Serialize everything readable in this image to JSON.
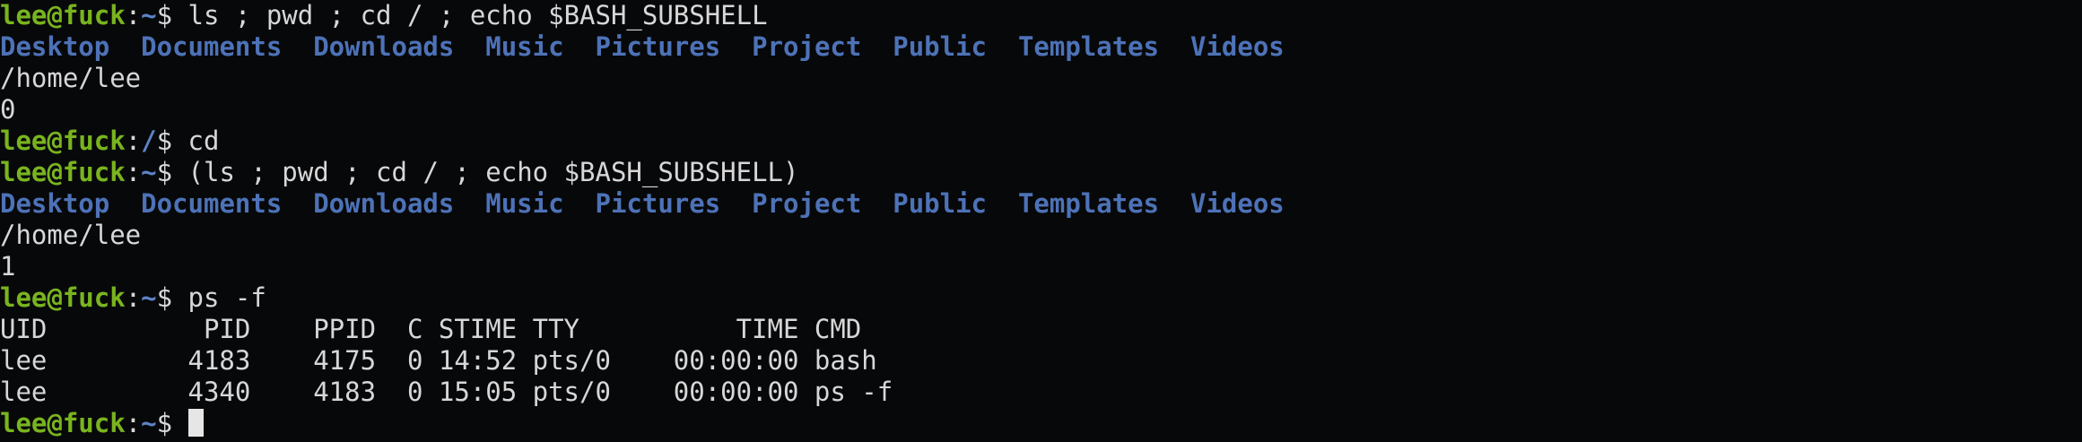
{
  "prompt": {
    "user_host": "lee@fuck",
    "colon": ":",
    "home_path": "~",
    "root_path": "/",
    "suffix": "$ "
  },
  "lines": {
    "cmd1": "ls ; pwd ; cd / ; echo $BASH_SUBSHELL",
    "ls1": [
      "Desktop",
      "Documents",
      "Downloads",
      "Music",
      "Pictures",
      "Project",
      "Public",
      "Templates",
      "Videos"
    ],
    "pwd1": "/home/lee",
    "subshell1": "0",
    "cmd2": "cd",
    "cmd3": "(ls ; pwd ; cd / ; echo $BASH_SUBSHELL)",
    "ls2": [
      "Desktop",
      "Documents",
      "Downloads",
      "Music",
      "Pictures",
      "Project",
      "Public",
      "Templates",
      "Videos"
    ],
    "pwd2": "/home/lee",
    "subshell2": "1",
    "cmd4": "ps -f"
  },
  "ps_table": {
    "header": "UID          PID    PPID  C STIME TTY          TIME CMD",
    "rows": [
      "lee         4183    4175  0 14:52 pts/0    00:00:00 bash",
      "lee         4340    4183  0 15:05 pts/0    00:00:00 ps -f"
    ]
  }
}
